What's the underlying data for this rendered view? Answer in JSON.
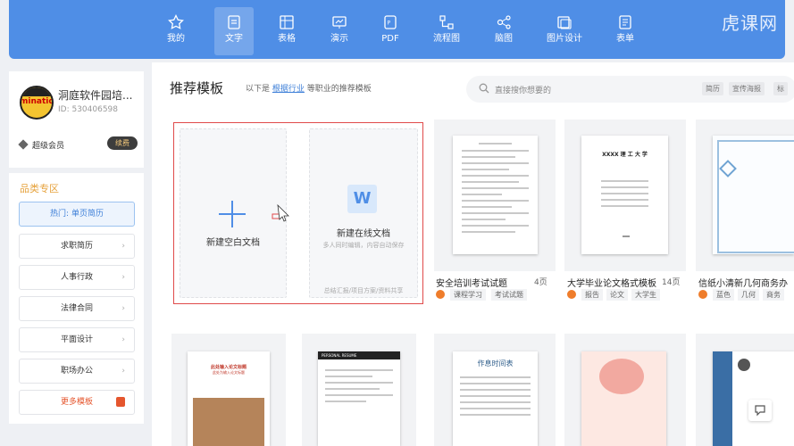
{
  "nav": {
    "tabs": [
      {
        "label": "我的",
        "icon": "star-icon",
        "active": false
      },
      {
        "label": "文字",
        "icon": "document-icon",
        "active": true
      },
      {
        "label": "表格",
        "icon": "table-icon",
        "active": false
      },
      {
        "label": "演示",
        "icon": "presentation-icon",
        "active": false
      },
      {
        "label": "PDF",
        "icon": "pdf-icon",
        "active": false
      },
      {
        "label": "流程图",
        "icon": "flowchart-icon",
        "active": false
      },
      {
        "label": "脑图",
        "icon": "mindmap-icon",
        "active": false
      },
      {
        "label": "图片设计",
        "icon": "image-design-icon",
        "active": false
      },
      {
        "label": "表单",
        "icon": "form-icon",
        "active": false
      }
    ],
    "watermark": "虎课网"
  },
  "user": {
    "name": "洞庭软件园培...",
    "id": "ID: 530406598",
    "member": "超级会员",
    "renew": "续费",
    "avatar_text": "mination"
  },
  "categories": {
    "heading": "品类专区",
    "hot": "热门: 单页简历",
    "items": [
      "求职简历",
      "人事行政",
      "法律合同",
      "平面设计",
      "职场办公"
    ],
    "more": "更多模板"
  },
  "main": {
    "title": "推荐模板",
    "subtitle_prefix": "以下是",
    "subtitle_link": "根据行业",
    "subtitle_suffix": "等职业的推荐模板",
    "search_placeholder": "直接搜你想要的",
    "search_tags": [
      "简历",
      "宣传海报",
      "标"
    ]
  },
  "new_blank": {
    "label": "新建空白文档"
  },
  "new_online": {
    "label": "新建在线文档",
    "desc": "多人同时编辑，内容自动保存",
    "hint": "总结汇报/项目方案/资料共享",
    "icon_letter": "W"
  },
  "templates": [
    {
      "name": "安全培训考试试题",
      "pages": "4页",
      "tags": [
        "课程学习",
        "考试试题"
      ]
    },
    {
      "name": "大学毕业论文格式模板",
      "pages": "14页",
      "tags": [
        "报告",
        "论文",
        "大学生"
      ],
      "doc_title": "XXXX 理 工 大 学"
    },
    {
      "name": "信纸小清新几何商务办",
      "pages": "",
      "tags": [
        "蓝色",
        "几何",
        "商务"
      ]
    }
  ],
  "row2": [
    {
      "doc_title": "此处输入论文标题",
      "doc_sub": "此处为输入论文标题"
    },
    {
      "doc_title": "PERSONAL RESUME"
    },
    {
      "doc_title": "作息时间表"
    },
    {
      "doc_title": ""
    },
    {
      "doc_title": ""
    }
  ],
  "colors": {
    "accent": "#4f8ee6",
    "selected_border": "#e04a4a",
    "orange": "#ef7d2b"
  }
}
